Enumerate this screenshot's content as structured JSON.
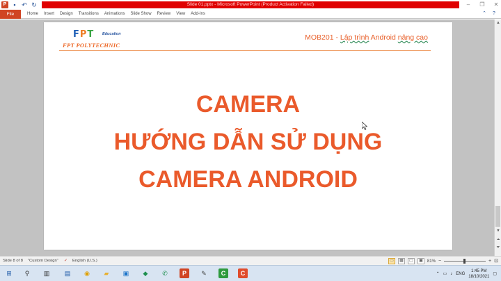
{
  "window": {
    "title": "Slide 01.pptx - Microsoft PowerPoint (Product Activation Failed)",
    "controls": [
      "minimize",
      "restore",
      "close"
    ]
  },
  "qat": {
    "icons": [
      "powerpoint-logo-icon",
      "save-icon",
      "undo-icon",
      "redo-icon",
      "customize-icon"
    ]
  },
  "ribbon": {
    "file_label": "File",
    "tabs": [
      "Home",
      "Insert",
      "Design",
      "Transitions",
      "Animations",
      "Slide Show",
      "Review",
      "View",
      "Add-Ins"
    ]
  },
  "slide": {
    "logo": {
      "letters": [
        "F",
        "P",
        "T"
      ],
      "letter_colors": [
        "#1f5fb6",
        "#ee7d24",
        "#3aa544"
      ],
      "edu": "Education",
      "poly": "FPT POLYTECHNIC"
    },
    "course": {
      "prefix": "MOB201 - ",
      "underlined_1": "Lập trình",
      "middle": " Android ",
      "underlined_2": "nâng cao"
    },
    "title_lines": [
      "CAMERA",
      "HƯỚNG DẪN SỬ DỤNG",
      "CAMERA ANDROID"
    ],
    "accent_color": "#ea5a2b"
  },
  "statusbar": {
    "slide_info": "Slide 8 of 8",
    "theme": "\"Custom Design\"",
    "language": "English (U.S.)",
    "zoom": "81%"
  },
  "taskbar": {
    "language": "ENG",
    "time": "1:45 PM",
    "date": "18/10/2021"
  }
}
